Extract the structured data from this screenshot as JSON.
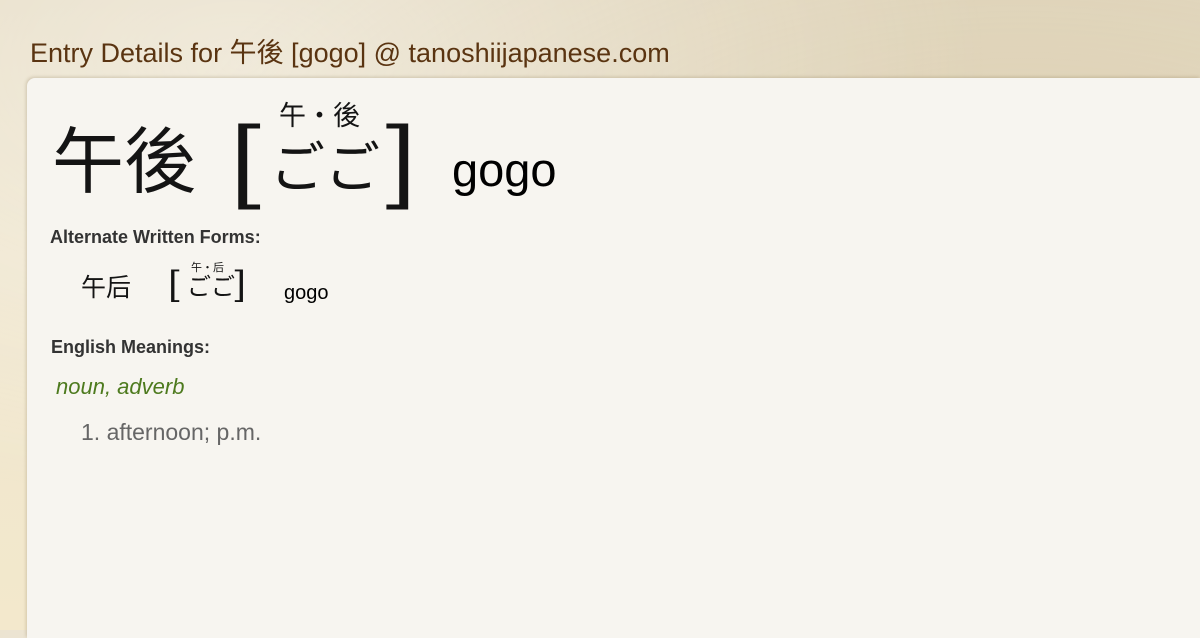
{
  "page": {
    "title": "Entry Details for 午後 [gogo] @ tanoshiijapanese.com"
  },
  "entry": {
    "kanji": "午後",
    "ruby": "午・後",
    "kana": "ごご",
    "romaji": "gogo",
    "open_bracket": "[",
    "close_bracket": "]"
  },
  "alternate_forms": {
    "label": "Alternate Written Forms:",
    "items": [
      {
        "kanji": "午后",
        "ruby": "午・后",
        "kana": "ごご",
        "romaji": "gogo"
      }
    ]
  },
  "meanings": {
    "label": "English Meanings:",
    "part_of_speech": "noun, adverb",
    "items": [
      {
        "text": "1. afternoon; p.m."
      }
    ]
  },
  "colors": {
    "title": "#5a3411",
    "part_of_speech": "#4d7a1e",
    "meaning": "#666666",
    "panel_bg": "#f7f5f0"
  }
}
